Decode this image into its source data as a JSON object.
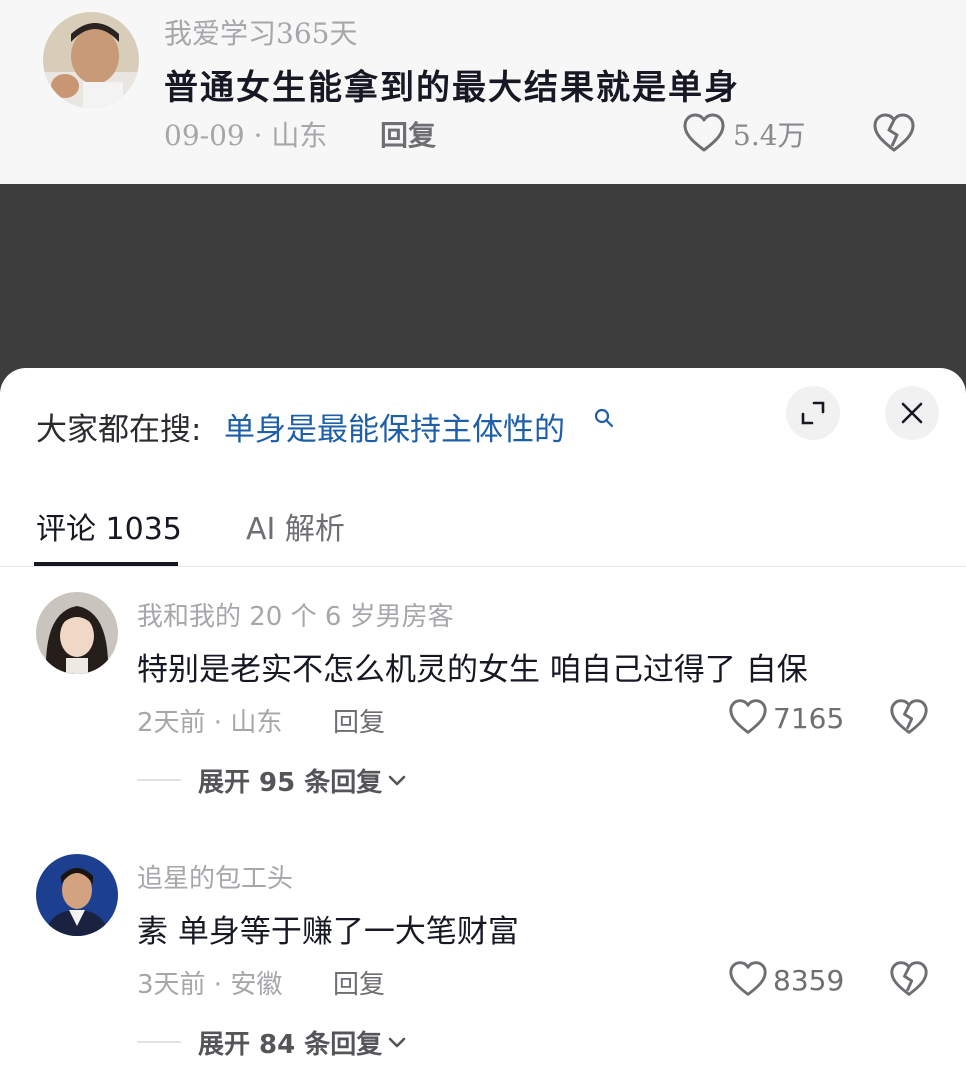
{
  "top_comment": {
    "username": "我爱学习365天",
    "text": "普通女生能拿到的最大结果就是单身",
    "meta": "09-09 · 山东",
    "reply_label": "回复",
    "like_count": "5.4万"
  },
  "sheet": {
    "search_prefix": "大家都在搜:",
    "search_term": "单身是最能保持主体性的",
    "tabs": [
      {
        "label": "评论 1035",
        "active": true
      },
      {
        "label": "AI 解析",
        "active": false
      }
    ]
  },
  "comments": [
    {
      "username": "我和我的 20 个 6 岁男房客",
      "text": "特别是老实不怎么机灵的女生 咱自己过得了 自保",
      "meta": "2天前 · 山东",
      "reply_label": "回复",
      "like_count": "7165",
      "expand_label": "展开 95 条回复"
    },
    {
      "username": "追星的包工头",
      "text": "素 单身等于赚了一大笔财富",
      "meta": "3天前 · 安徽",
      "reply_label": "回复",
      "like_count": "8359",
      "expand_label": "展开 84 条回复"
    }
  ],
  "icons": {
    "like": "heart-outline-icon",
    "dislike": "broken-heart-icon",
    "search": "search-icon",
    "expand": "expand-icon",
    "close": "close-icon",
    "chevron": "chevron-down-icon"
  },
  "colors": {
    "search_link": "#1f5fa8",
    "backdrop": "#3d3d3d",
    "muted_text": "#a7a7ab"
  }
}
